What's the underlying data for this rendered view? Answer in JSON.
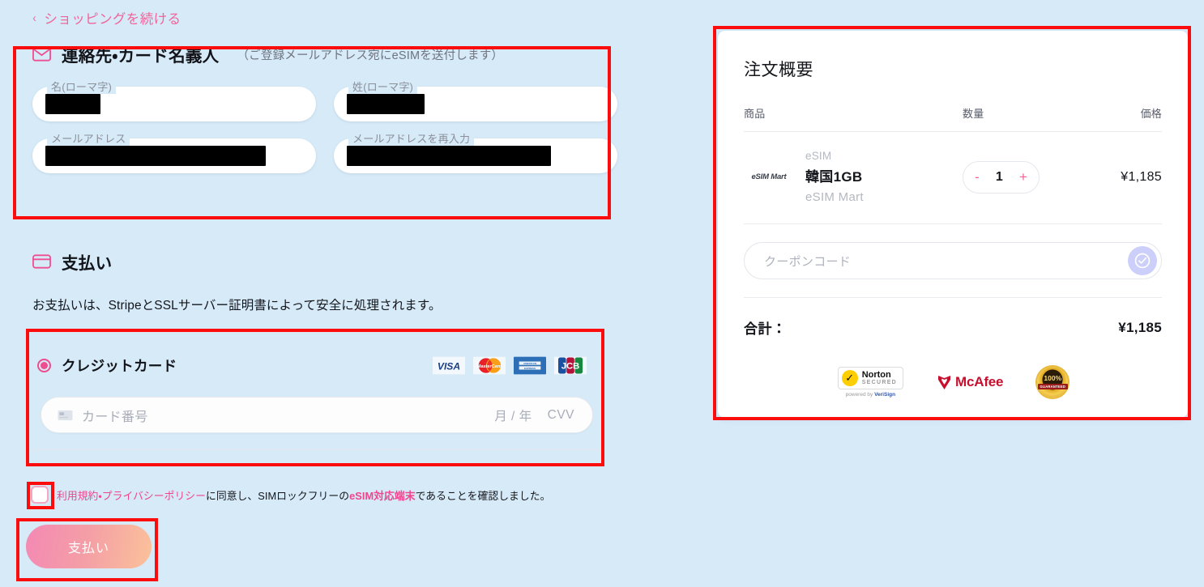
{
  "page": {
    "background_color": "#d6eaf8",
    "accent_pink": "#f0458c",
    "annotation_color": "#fc0d0d"
  },
  "nav": {
    "back_link": "ショッピングを続ける",
    "chevron": "‹"
  },
  "contact": {
    "icon": "mail-icon",
    "title": "連絡先・カード名義人",
    "note": "（ご登録メールアドレス宛にeSIMを送付します）",
    "fields": [
      {
        "label": "名(ローマ字)",
        "value": "",
        "redacted": true,
        "redact_width": 68
      },
      {
        "label": "姓(ローマ字)",
        "value": "",
        "redacted": true,
        "redact_width": 96
      },
      {
        "label": "メールアドレス",
        "value": "",
        "redacted": true,
        "redact_width": 272
      },
      {
        "label": "メールアドレスを再入力",
        "value": "",
        "redacted": true,
        "redact_width": 252
      }
    ]
  },
  "payment": {
    "icon": "credit-card-icon",
    "title": "支払い",
    "stripe_note": "お支払いは、StripeとSSLサーバー証明書によって安全に処理されます。",
    "method": {
      "selected": true,
      "label": "クレジットカード",
      "brands": [
        "VISA",
        "MasterCard",
        "AMERICAN EXPRESS",
        "JCB"
      ]
    },
    "card_input": {
      "icon": "card-chip-icon",
      "placeholder": "カード番号",
      "expiry_placeholder": "月 / 年",
      "cvv_placeholder": "CVV",
      "value": ""
    }
  },
  "terms": {
    "checked": false,
    "link1": "利用規約・プライバシーポリシー",
    "mid": "に同意し、SIMロックフリーの",
    "link2": "eSIM対応端末",
    "tail": "であることを確認しました。"
  },
  "submit": {
    "label": "支払い"
  },
  "summary": {
    "title": "注文概要",
    "columns": {
      "item": "商品",
      "qty": "数量",
      "price": "価格"
    },
    "line_items": [
      {
        "logo_text": "eSIM Mart",
        "category": "eSIM",
        "name": "韓国1GB",
        "vendor": "eSIM Mart",
        "qty": "1",
        "minus": "-",
        "plus": "+",
        "price": "¥1,185"
      }
    ],
    "coupon": {
      "placeholder": "クーポンコード",
      "value": "",
      "apply_icon": "check-circle-icon"
    },
    "total_label": "合計：",
    "total_value": "¥1,185",
    "badges": [
      {
        "name": "norton-secured",
        "title": "Norton",
        "sub": "SECURED",
        "footer_pre": "powered by ",
        "footer_brand": "VeriSign"
      },
      {
        "name": "mcafee",
        "title": "McAfee"
      },
      {
        "name": "guarantee-100",
        "title": "100%",
        "sub": "GUARANTEED"
      }
    ]
  },
  "annotations": [
    {
      "name": "contact-section-highlight"
    },
    {
      "name": "order-summary-highlight"
    },
    {
      "name": "credit-card-block-highlight"
    },
    {
      "name": "terms-checkbox-highlight"
    },
    {
      "name": "pay-button-highlight"
    }
  ]
}
